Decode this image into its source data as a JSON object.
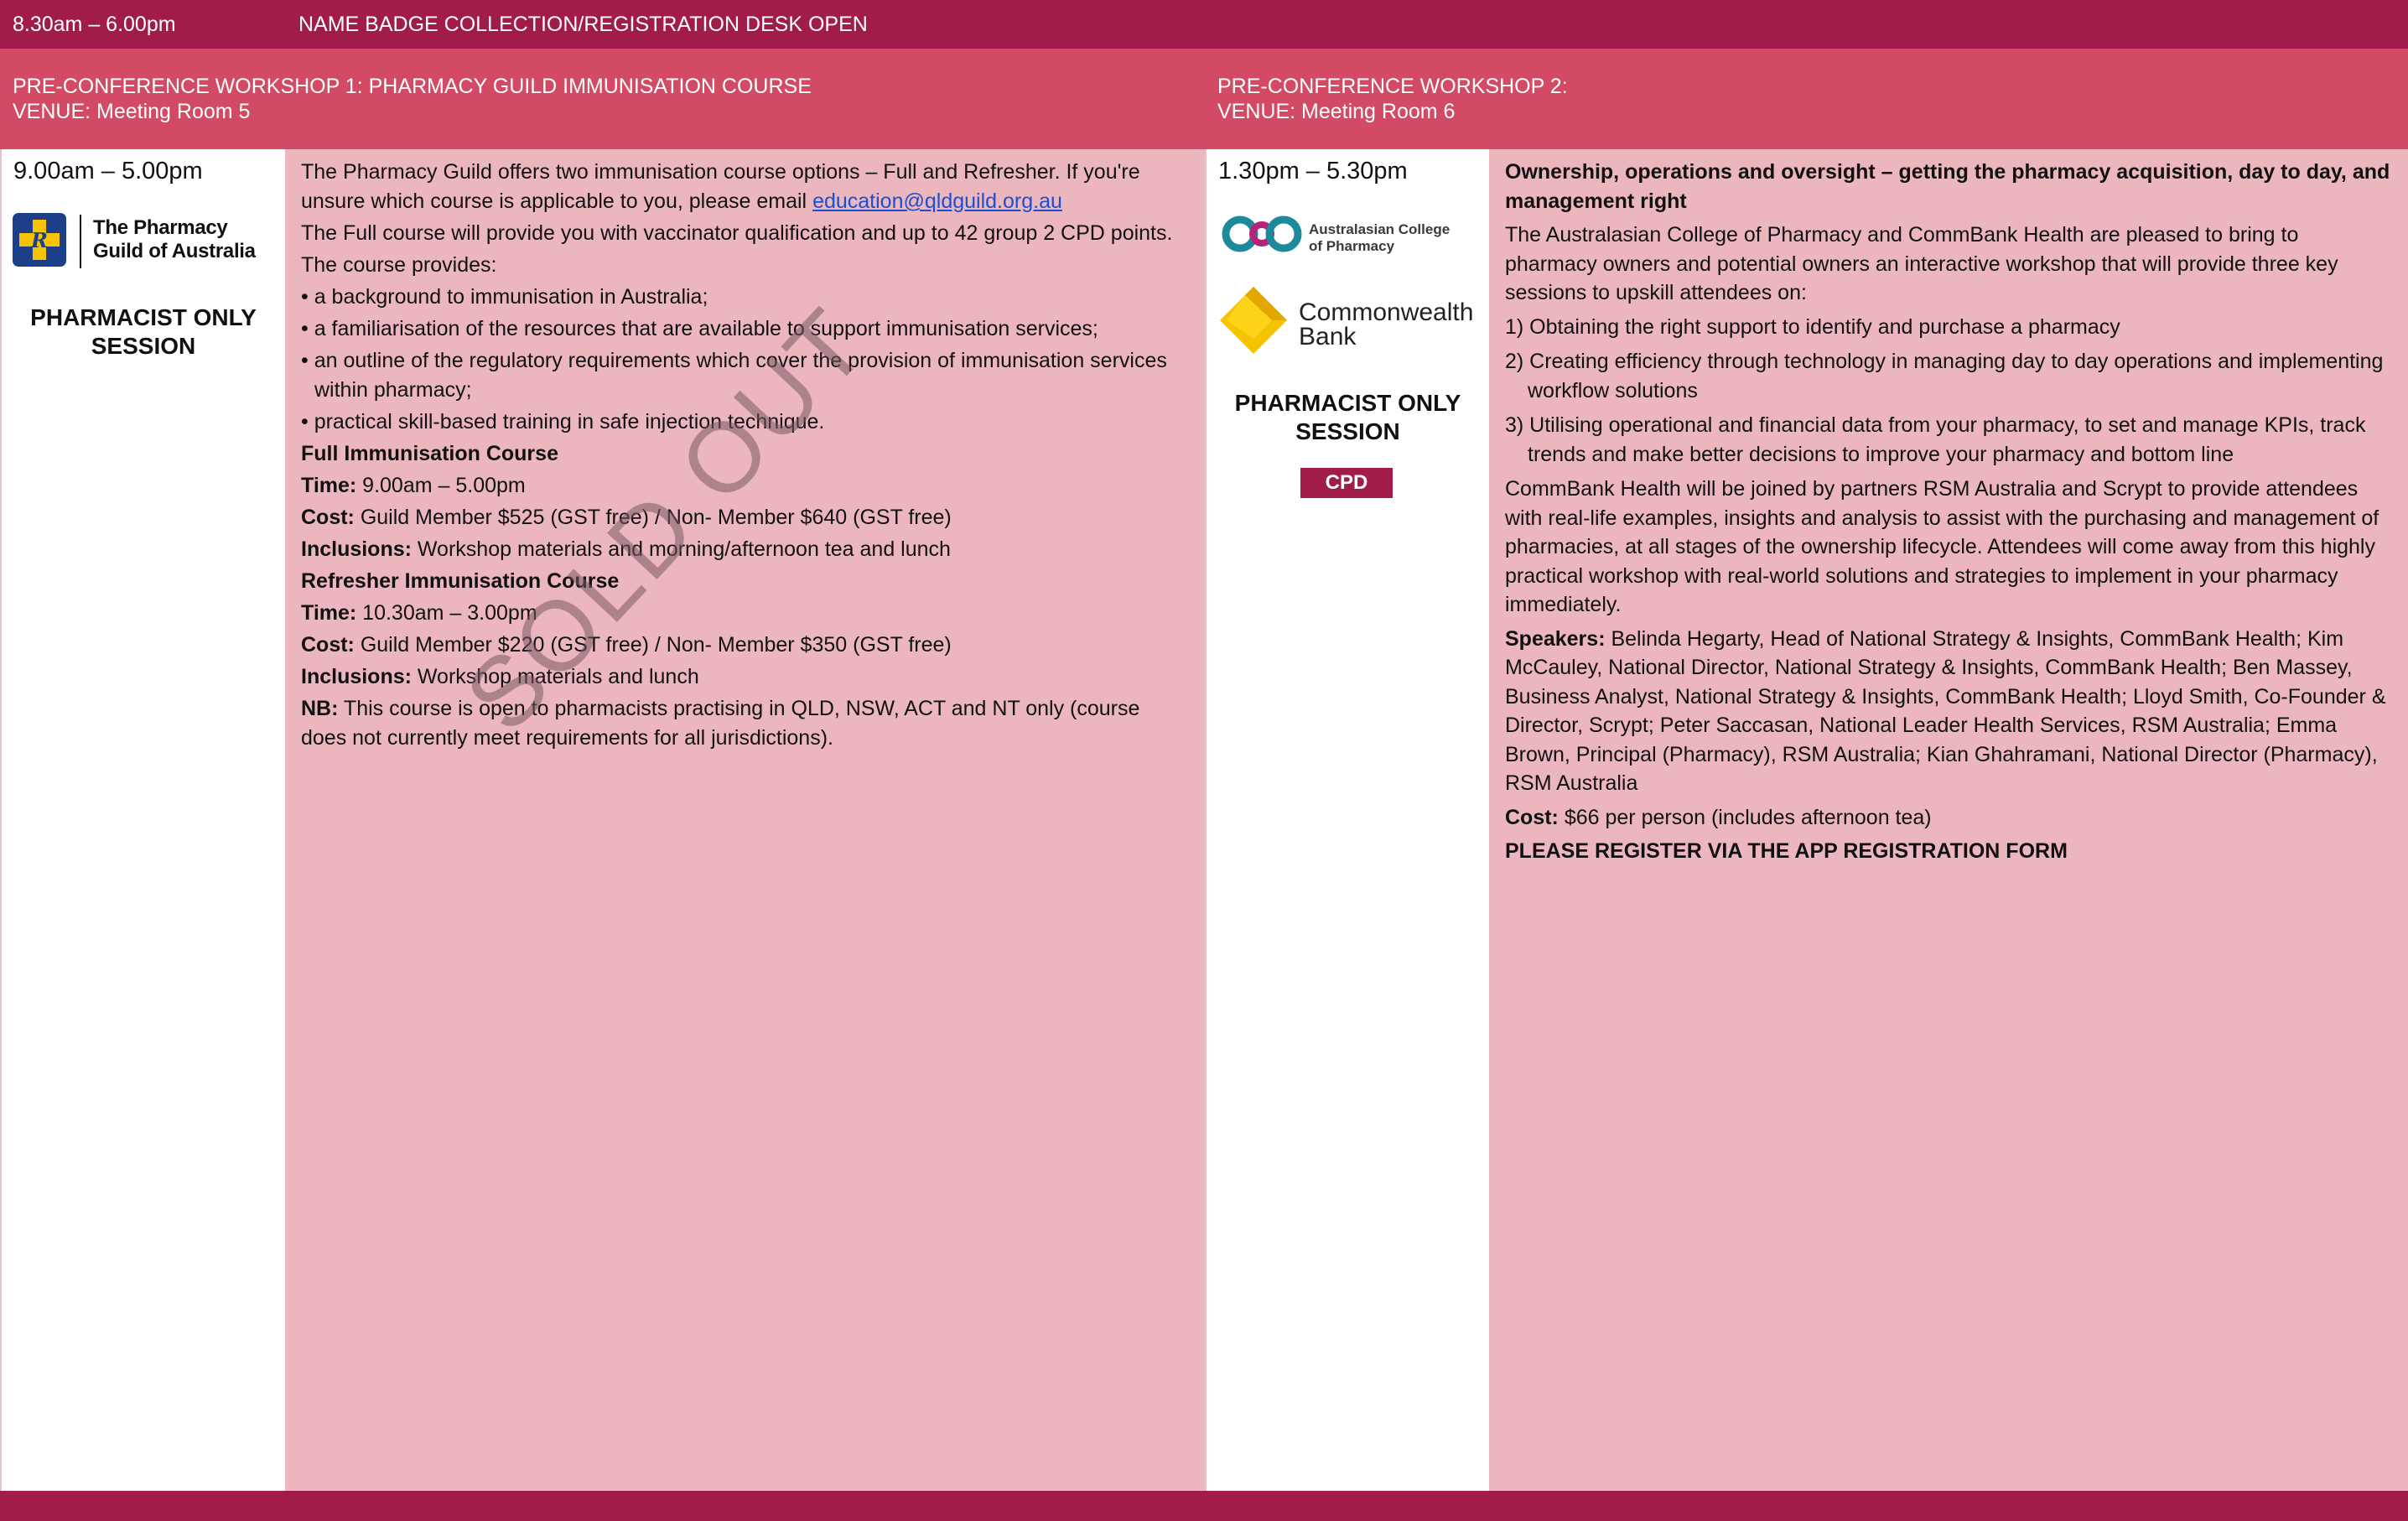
{
  "colors": {
    "dark_band": "#a11c4a",
    "mid_band": "#d24a63",
    "light_panel": "#ecb6bf",
    "logo_yellow": "#f5c400",
    "logo_blue": "#1d3f8a",
    "acp_teal": "#1c8a9a",
    "acp_magenta": "#b5247a"
  },
  "top_bar": {
    "time": "8.30am – 6.00pm",
    "description": "NAME BADGE COLLECTION/REGISTRATION DESK OPEN"
  },
  "workshop1": {
    "title": "PRE-CONFERENCE WORKSHOP 1: PHARMACY GUILD IMMUNISATION COURSE",
    "venue": "VENUE: Meeting Room 5",
    "time": "9.00am – 5.00pm",
    "logo": {
      "icon": "pharmacy-guild-cross-icon",
      "line1": "The Pharmacy",
      "line2": "Guild of Australia"
    },
    "session_label_line1": "PHARMACIST ONLY",
    "session_label_line2": "SESSION",
    "watermark": "SOLD OUT",
    "intro_1": "The Pharmacy Guild offers two immunisation course options – Full and Refresher. If you're",
    "intro_2": "unsure which course is applicable to you, please email ",
    "email": "education@qldguild.org.au",
    "full_intro": "The Full course will provide you with vaccinator qualification and up to 42 group 2 CPD points.",
    "provides": "The course provides:",
    "bullets": [
      "• a background to immunisation in Australia;",
      "• a familiarisation of the resources that are available to support immunisation services;",
      "• an outline of the regulatory requirements which cover the provision of immunisation services within pharmacy;",
      "• practical skill-based training in safe injection technique."
    ],
    "full_course": {
      "heading": "Full Immunisation Course",
      "time_label": "Time:",
      "time_value": " 9.00am – 5.00pm",
      "cost_label": "Cost:",
      "cost_value": " Guild Member $525 (GST free) / Non- Member $640 (GST free)",
      "inclusions_label": "Inclusions:",
      "inclusions_value": " Workshop materials and morning/afternoon tea and lunch"
    },
    "refresher_course": {
      "heading": "Refresher Immunisation Course",
      "time_label": "Time:",
      "time_value": " 10.30am – 3.00pm",
      "cost_label": "Cost:",
      "cost_value": " Guild Member $220 (GST free) / Non- Member $350 (GST free)",
      "inclusions_label": "Inclusions:",
      "inclusions_value": " Workshop materials and lunch"
    },
    "nb_label": "NB:",
    "nb_value": " This course is open to pharmacists practising in QLD, NSW, ACT and NT only (course does not currently meet requirements for all jurisdictions)."
  },
  "workshop2": {
    "title": "PRE-CONFERENCE WORKSHOP 2:",
    "venue": "VENUE: Meeting Room 6",
    "time": "1.30pm – 5.30pm",
    "logo_acp": {
      "icon": "acp-logo-icon",
      "line1": "Australasian College",
      "line2": "of Pharmacy"
    },
    "logo_cba": {
      "icon": "commonwealth-bank-diamond-icon",
      "line1": "Commonwealth",
      "line2": "Bank"
    },
    "session_label_line1": "PHARMACIST ONLY",
    "session_label_line2": "SESSION",
    "badge": "CPD",
    "heading": "Ownership, operations and oversight – getting the pharmacy acquisition, day to day, and management right",
    "intro": "The Australasian College of Pharmacy and CommBank Health are pleased to bring to pharmacy owners and potential owners an interactive workshop that will provide three key sessions to upskill attendees on:",
    "points": [
      "1) Obtaining the right support to identify and purchase a pharmacy",
      "2) Creating efficiency through technology in managing day to day operations and implementing workflow solutions",
      "3) Utilising operational and financial data from your pharmacy, to set and manage KPIs, track trends and make better decisions to improve your pharmacy and bottom line"
    ],
    "partners": "CommBank Health will be joined by partners RSM Australia and Scrypt to provide attendees with real-life examples, insights and analysis to assist with the purchasing and management of pharmacies, at all stages of the ownership lifecycle. Attendees will come away from this highly practical workshop with real-world solutions and strategies to implement in your pharmacy immediately.",
    "speakers_label": "Speakers:",
    "speakers_value": " Belinda Hegarty, Head of National Strategy & Insights, CommBank Health; Kim McCauley, National Director, National Strategy & Insights, CommBank Health; Ben Massey, Business Analyst, National Strategy & Insights, CommBank Health; Lloyd Smith, Co-Founder & Director, Scrypt; Peter Saccasan, National Leader Health Services, RSM Australia; Emma Brown, Principal (Pharmacy), RSM Australia; Kian Ghahramani, National Director (Pharmacy), RSM Australia",
    "cost_label": "Cost:",
    "cost_value": " $66 per person (includes afternoon tea)",
    "register": "PLEASE REGISTER VIA THE APP REGISTRATION FORM"
  }
}
